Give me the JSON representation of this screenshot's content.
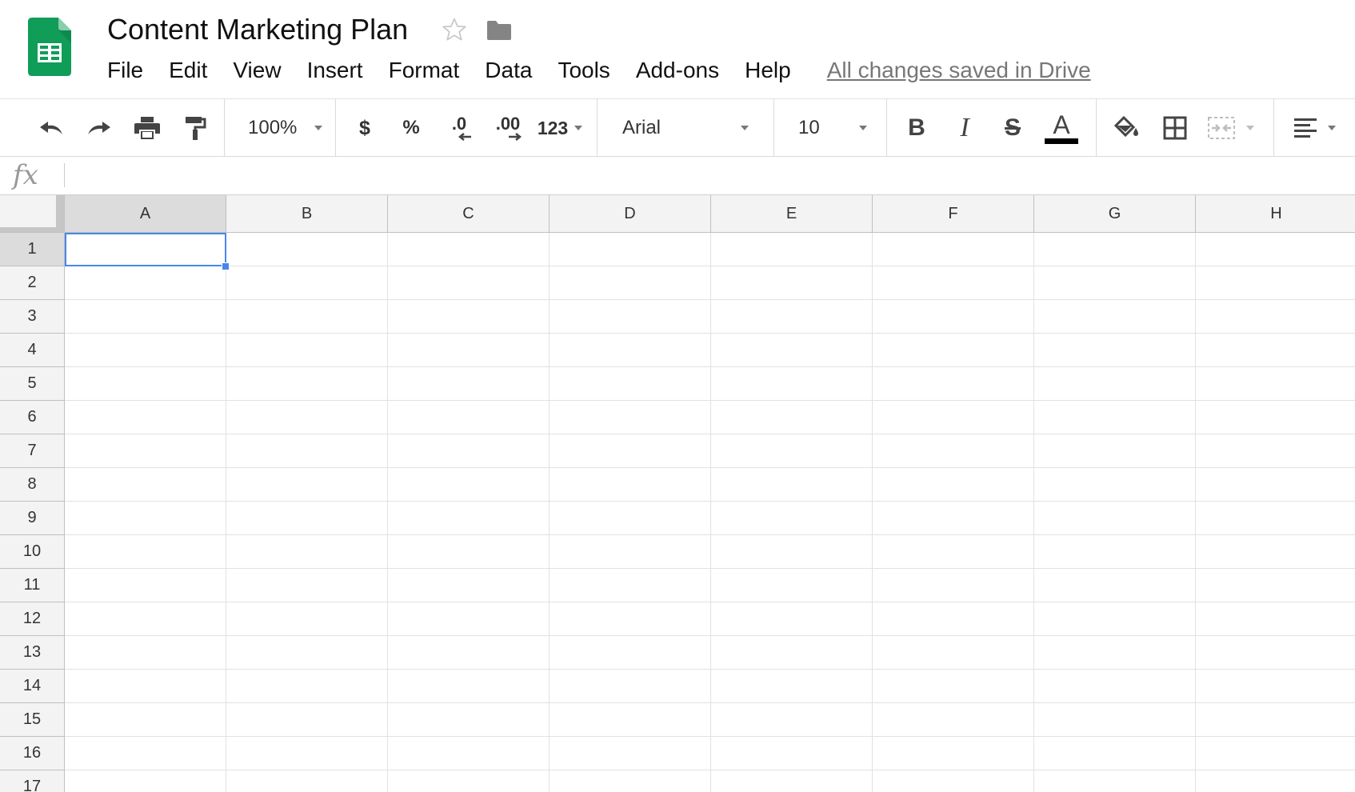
{
  "document": {
    "title": "Content Marketing Plan",
    "save_status": "All changes saved in Drive",
    "app_icon": "google-sheets-icon",
    "brand_color": "#0f9d58"
  },
  "menu": [
    "File",
    "Edit",
    "View",
    "Insert",
    "Format",
    "Data",
    "Tools",
    "Add-ons",
    "Help"
  ],
  "toolbar": {
    "zoom": "100%",
    "currency_label": "$",
    "percent_label": "%",
    "decrease_decimal_label": ".0",
    "increase_decimal_label": ".00",
    "more_formats_label": "123",
    "font_family": "Arial",
    "font_size": "10",
    "bold_label": "B",
    "italic_label": "I",
    "strikethrough_label": "S",
    "text_color_label": "A",
    "text_color": "#000000"
  },
  "formula_bar": {
    "fx_label": "fx",
    "value": ""
  },
  "grid": {
    "columns": [
      "A",
      "B",
      "C",
      "D",
      "E",
      "F",
      "G",
      "H"
    ],
    "rows": [
      "1",
      "2",
      "3",
      "4",
      "5",
      "6",
      "7",
      "8",
      "9",
      "10",
      "11",
      "12",
      "13",
      "14",
      "15",
      "16",
      "17"
    ],
    "selected_cell": "A1",
    "selection_color": "#4a86e8"
  }
}
